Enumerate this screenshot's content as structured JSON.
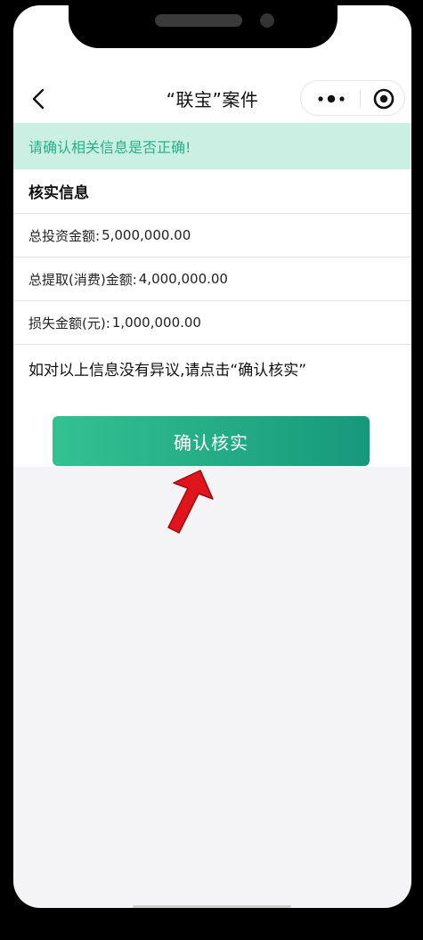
{
  "nav": {
    "title": "“联宝”案件",
    "back_icon": "chevron-left-icon",
    "more_icon": "more-dots-icon",
    "close_icon": "target-icon"
  },
  "notice": {
    "text": "请确认相关信息是否正确!"
  },
  "section": {
    "title": "核实信息"
  },
  "rows": [
    {
      "label": "总投资金额:",
      "value": "5,000,000.00"
    },
    {
      "label": "总提取(消费)金额:",
      "value": "4,000,000.00"
    },
    {
      "label": "损失金额(元):",
      "value": "1,000,000.00"
    }
  ],
  "hint": {
    "text": "如对以上信息没有异议,请点击“确认核实”"
  },
  "confirm_button": {
    "label": "确认核实"
  },
  "colors": {
    "notice_bg": "#c9f0e2",
    "notice_text": "#2aaf86",
    "button_start": "#34c191",
    "button_end": "#16997b",
    "arrow": "#e0141c"
  }
}
